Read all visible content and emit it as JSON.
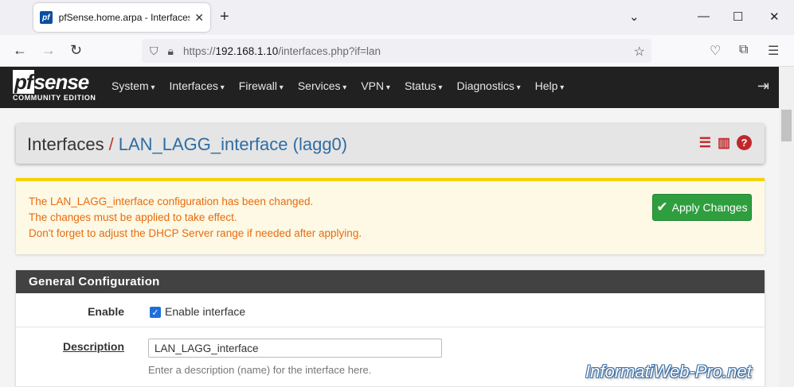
{
  "browser": {
    "tab_title": "pfSense.home.arpa - Interfaces: LAN_LAGG_interface (lagg0)",
    "favicon_text": "pf",
    "url_prefix": "https://",
    "url_host": "192.168.1.10",
    "url_path": "/interfaces.php?if=lan"
  },
  "header": {
    "logo_pf": "pf",
    "logo_sense": "sense",
    "logo_sub": "COMMUNITY EDITION",
    "menu": [
      "System",
      "Interfaces",
      "Firewall",
      "Services",
      "VPN",
      "Status",
      "Diagnostics",
      "Help"
    ]
  },
  "breadcrumb": {
    "root": "Interfaces",
    "separator": "/",
    "current": "LAN_LAGG_interface (lagg0)"
  },
  "alert": {
    "lines": [
      "The LAN_LAGG_interface configuration has been changed.",
      "The changes must be applied to take effect.",
      "Don't forget to adjust the DHCP Server range if needed after applying."
    ],
    "apply_label": "Apply Changes"
  },
  "general": {
    "title": "General Configuration",
    "enable_label": "Enable",
    "enable_checkbox_label": "Enable interface",
    "enable_checked": true,
    "description_label": "Description",
    "description_value": "LAN_LAGG_interface",
    "description_help": "Enter a description (name) for the interface here."
  },
  "watermark": "InformatiWeb-Pro.net",
  "colors": {
    "header_bg": "#212121",
    "accent_red": "#c0272d",
    "link_blue": "#2e6da4",
    "warning_orange": "#e86b10",
    "apply_green": "#2e9e3e",
    "section_head": "#424242"
  },
  "icons": [
    "sliders-icon",
    "bar-chart-icon",
    "help-icon",
    "logout-icon",
    "star-icon",
    "shield-icon",
    "lock-icon"
  ]
}
